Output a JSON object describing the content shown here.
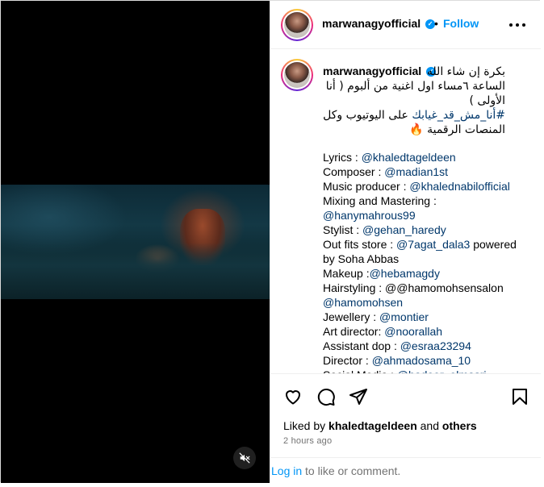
{
  "header": {
    "username": "marwanagyofficial",
    "separator": "•",
    "follow_label": "Follow"
  },
  "caption": {
    "username": "marwanagyofficial",
    "arabic_line1": "بكرة إن شاء الله",
    "arabic_line2": "الساعة ٦مساء اول اغنية من ألبوم ( أنا",
    "arabic_line3": "الأولى )",
    "arabic_hashtag": "#أنا_مش_قد_غيابك",
    "arabic_line4_rest": " على اليوتيوب وكل",
    "arabic_line5": "المنصات الرقمية 🔥",
    "credits": [
      {
        "label": "Lyrics : ",
        "mention": "@khaledtageldeen",
        "rest": ""
      },
      {
        "label": "Composer : ",
        "mention": "@madian1st",
        "rest": ""
      },
      {
        "label": "Music producer : ",
        "mention": "@khalednabilofficial",
        "rest": ""
      },
      {
        "label": "Mixing and Mastering :",
        "mention": "",
        "rest": ""
      },
      {
        "label": "",
        "mention": "@hanymahrous99",
        "rest": ""
      },
      {
        "label": "Stylist : ",
        "mention": "@gehan_haredy",
        "rest": ""
      },
      {
        "label": "Out fits store : ",
        "mention": "@7agat_dala3",
        "rest": " powered"
      },
      {
        "label": "by Soha Abbas",
        "mention": "",
        "rest": ""
      },
      {
        "label": "Makeup :",
        "mention": "@hebamagdy",
        "rest": ""
      },
      {
        "label": "Hairstyling : @@hamomohsensalon",
        "mention": "",
        "rest": ""
      },
      {
        "label": "",
        "mention": "@hamomohsen",
        "rest": ""
      },
      {
        "label": "Jewellery : ",
        "mention": "@montier",
        "rest": ""
      },
      {
        "label": "Art director: ",
        "mention": "@noorallah",
        "rest": ""
      },
      {
        "label": "Assistant dop : ",
        "mention": "@esraa23294",
        "rest": ""
      },
      {
        "label": "Director : ",
        "mention": "@ahmadosama_10",
        "rest": ""
      },
      {
        "label": "Social Media : ",
        "mention": "@hadeer_elmasri",
        "rest": ""
      }
    ]
  },
  "likes": {
    "prefix": "Liked by ",
    "user": "khaledtageldeen",
    "middle": " and ",
    "others": "others"
  },
  "timestamp": "2 hours ago",
  "login": {
    "link": "Log in",
    "rest": " to like or comment."
  },
  "icons": {
    "verified": "verified-badge-icon",
    "more": "more-options-icon",
    "like": "heart-icon",
    "comment": "comment-icon",
    "share": "share-icon",
    "save": "bookmark-icon",
    "mute": "speaker-muted-icon"
  },
  "colors": {
    "accent": "#0095f6",
    "link": "#00376b",
    "secondary_text": "#737373",
    "border": "#dbdbdb"
  }
}
